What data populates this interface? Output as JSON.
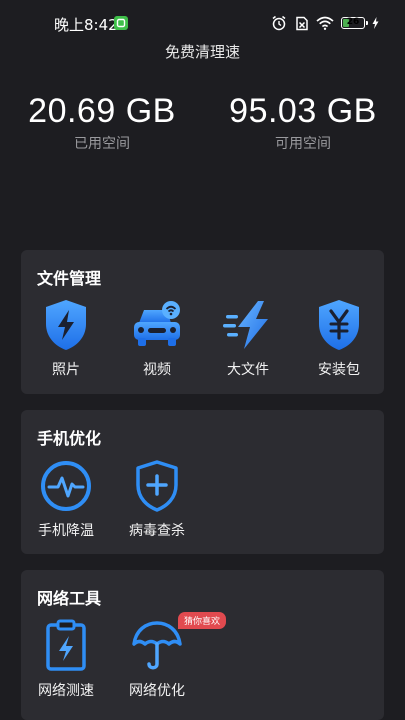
{
  "status_bar": {
    "time": "晚上8:42",
    "battery_level": "26",
    "icons": [
      "app-notification-icon",
      "alarm-icon",
      "sim-off-icon",
      "wifi-icon",
      "battery-icon",
      "charging-icon"
    ]
  },
  "header": {
    "title": "免费清理速"
  },
  "storage": {
    "used": {
      "value": "20.69 GB",
      "label": "已用空间"
    },
    "available": {
      "value": "95.03 GB",
      "label": "可用空间"
    }
  },
  "sections": {
    "file_management": {
      "title": "文件管理",
      "items": [
        {
          "label": "照片",
          "icon": "shield-bolt-icon"
        },
        {
          "label": "视频",
          "icon": "car-wifi-icon"
        },
        {
          "label": "大文件",
          "icon": "speed-bolt-icon"
        },
        {
          "label": "安装包",
          "icon": "shield-yen-icon"
        }
      ]
    },
    "phone_optimize": {
      "title": "手机优化",
      "items": [
        {
          "label": "手机降温",
          "icon": "pulse-circle-icon"
        },
        {
          "label": "病毒查杀",
          "icon": "shield-plus-icon"
        }
      ]
    },
    "network_tools": {
      "title": "网络工具",
      "items": [
        {
          "label": "网络测速",
          "icon": "clipboard-bolt-icon"
        },
        {
          "label": "网络优化",
          "icon": "umbrella-icon",
          "badge": "猜你喜欢"
        }
      ]
    }
  },
  "colors": {
    "background": "#1d1d21",
    "card": "#2c2c31",
    "icon_blue": "#2f8ef5",
    "badge_red": "#e14a4f"
  }
}
